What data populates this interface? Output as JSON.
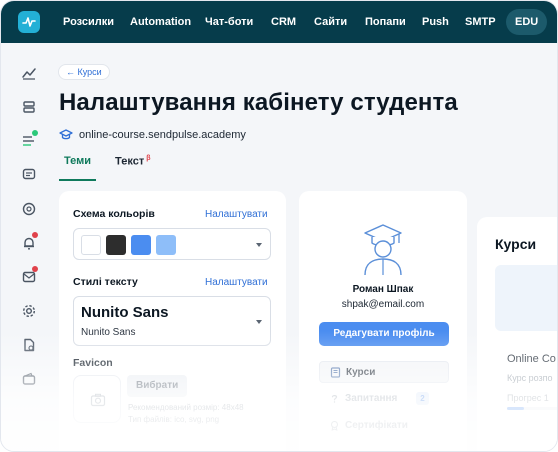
{
  "topnav": {
    "logo_icon": "pulse-logo-icon",
    "items": [
      {
        "label": "Розсилки"
      },
      {
        "label": "Automation"
      },
      {
        "label": "Чат-боти"
      },
      {
        "label": "CRM"
      },
      {
        "label": "Сайти"
      },
      {
        "label": "Попапи"
      },
      {
        "label": "Push"
      },
      {
        "label": "SMTP"
      },
      {
        "label": "EDU",
        "active": true
      }
    ]
  },
  "sidebar": {
    "icons": [
      "chart-icon",
      "layers-icon",
      "list-icon",
      "chat-icon",
      "support-icon",
      "bell-icon",
      "mail-icon",
      "settings-icon",
      "document-icon",
      "wallet-icon"
    ],
    "badges": {
      "list-icon": "#2bc97a",
      "bell-icon": "#e0424b",
      "mail-icon": "#e0424b"
    }
  },
  "header": {
    "back_label": "← Курси",
    "title": "Налаштування кабінету студента",
    "domain": "online-course.sendpulse.academy",
    "domain_icon": "graduation-cap-icon"
  },
  "tabs": [
    {
      "label": "Теми",
      "active": true
    },
    {
      "label": "Текст",
      "badge": "β"
    }
  ],
  "settings": {
    "color_scheme": {
      "label": "Схема кольорів",
      "link": "Налаштувати",
      "swatches": [
        "#ffffff",
        "#2d2d2d",
        "#4b8df0",
        "#8ebef9"
      ]
    },
    "text_style": {
      "label": "Стилі тексту",
      "link": "Налаштувати",
      "font_preview": "Nunito Sans",
      "font_name": "Nunito Sans"
    },
    "favicon": {
      "label": "Favicon",
      "choose_button": "Вибрати",
      "hint_size": "Рекомендований розмір: 48x48",
      "hint_types": "Тип файлів: ico, svg, png"
    }
  },
  "profile_preview": {
    "name": "Роман Шпак",
    "email": "shpak@email.com",
    "edit_button": "Редагувати профіль",
    "menu": [
      {
        "label": "Курси",
        "icon": "book-icon",
        "selected": true
      },
      {
        "label": "Запитання",
        "icon": "question-icon",
        "count": "2"
      },
      {
        "label": "Сертифікати",
        "icon": "certificate-icon"
      }
    ]
  },
  "courses_preview": {
    "title": "Курси",
    "course_name": "Online Co",
    "course_sub": "Курс розпо",
    "progress_label": "Прогрес 1",
    "progress": 0.15
  },
  "colors": {
    "nav_bg": "#063c4b",
    "accent_green": "#0f7a5c",
    "link_blue": "#2f6fd6",
    "button_blue": "#4b8df0"
  }
}
